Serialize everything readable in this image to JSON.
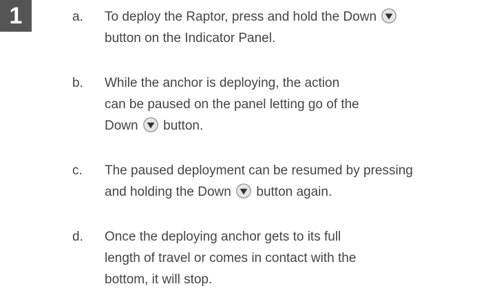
{
  "step_number": "1",
  "items": [
    {
      "letter": "a.",
      "lines": [
        [
          "To deploy the Raptor, press and hold the Down",
          "",
          ""
        ],
        [
          "button on the Indicator Panel.",
          "",
          ""
        ]
      ]
    },
    {
      "letter": "b.",
      "lines": [
        [
          "While the anchor is deploying, the action"
        ],
        [
          "can be paused on the panel letting go of the"
        ],
        [
          "Down",
          "button."
        ]
      ]
    },
    {
      "letter": "c.",
      "lines": [
        [
          "The paused deployment can be resumed by pressing"
        ],
        [
          "and holding the Down",
          "button again."
        ]
      ]
    },
    {
      "letter": "d.",
      "lines": [
        [
          "Once the deploying anchor gets to its full"
        ],
        [
          "length of travel or comes in contact with the"
        ],
        [
          "bottom, it will stop."
        ]
      ]
    }
  ],
  "icons": {
    "down_button": "down-arrow-button-icon"
  }
}
